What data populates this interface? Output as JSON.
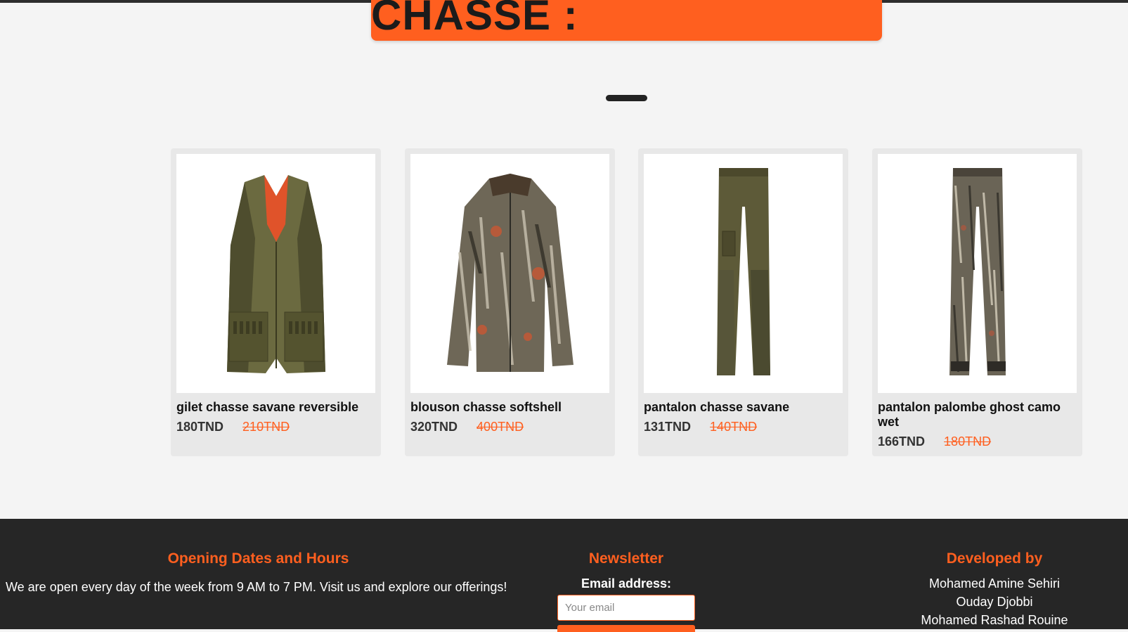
{
  "section": {
    "title": "VETEMENTS DE CHASSE :"
  },
  "products": [
    {
      "name": "gilet chasse savane reversible",
      "price": "180TND",
      "old_price": "210TND",
      "image": "hunting-vest-icon"
    },
    {
      "name": "blouson chasse softshell",
      "price": "320TND",
      "old_price": "400TND",
      "image": "camo-jacket-icon"
    },
    {
      "name": "pantalon chasse savane",
      "price": "131TND",
      "old_price": "140TND",
      "image": "hunting-pants-icon"
    },
    {
      "name": "pantalon palombe ghost camo wet",
      "price": "166TND",
      "old_price": "180TND",
      "image": "camo-pants-icon"
    }
  ],
  "footer": {
    "hours_title": "Opening Dates and Hours",
    "hours_text": "We are open every day of the week from 9 AM to 7 PM. Visit us and explore our offerings!",
    "newsletter_title": "Newsletter",
    "email_label": "Email address:",
    "email_placeholder": "Your email",
    "developed_title": "Developed by",
    "developers": [
      "Mohamed Amine Sehiri",
      "Ouday Djobbi",
      "Mohamed Rashad Rouine"
    ]
  },
  "colors": {
    "accent": "#ff5f1f",
    "footer_bg": "#262626",
    "page_bg": "#f4f4f4"
  }
}
